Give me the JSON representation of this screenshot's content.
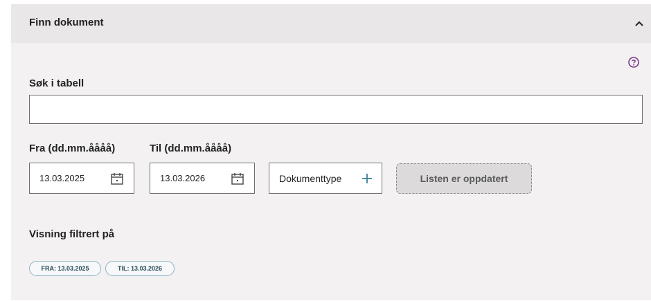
{
  "panel": {
    "title": "Finn dokument",
    "collapse_icon": "chevron-up-icon",
    "help_icon": "question-circle-icon"
  },
  "search": {
    "label": "Søk i tabell",
    "value": "",
    "placeholder": ""
  },
  "date_from": {
    "label": "Fra (dd.mm.åååå)",
    "value": "13.03.2025",
    "icon": "calendar-icon"
  },
  "date_to": {
    "label": "Til (dd.mm.åååå)",
    "value": "13.03.2026",
    "icon": "calendar-icon"
  },
  "doctype": {
    "label": "Dokumenttype",
    "icon": "plus-icon"
  },
  "refresh": {
    "label": "Listen er oppdatert"
  },
  "filters": {
    "heading": "Visning filtrert på",
    "chips": [
      "FRA: 13.03.2025",
      "TIL: 13.03.2026"
    ]
  },
  "colors": {
    "accent": "#3a7f95",
    "help": "#7a3a8c"
  }
}
